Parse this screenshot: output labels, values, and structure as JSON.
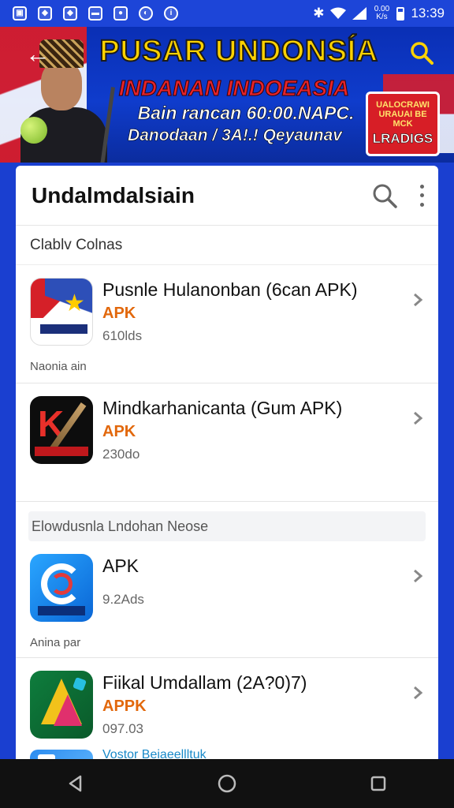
{
  "status_bar": {
    "time": "13:39",
    "data_label": "0.00 K/s",
    "icons": [
      "image-icon",
      "gallery-icon",
      "gallery-icon",
      "briefcase-icon",
      "camera-icon",
      "media-icon",
      "info-icon"
    ]
  },
  "banner": {
    "title": "PUSAR UNDONSÍA",
    "subtitle": "INDANAN INDOEASIA",
    "line1": "Bain rancan 60:00.NAPC.",
    "line2": "Danodaan / 3A!.! Qeyaunav",
    "badge_top": "UALOCRAWI URAUAI BE MCK",
    "badge_big": "LRADIGS"
  },
  "header": {
    "title": "Undalmdalsiain"
  },
  "section_label": "Clablv Colnas",
  "apps": [
    {
      "title": "Pusnle Hulanonban (6can APK)",
      "type": "APK",
      "size": "610lds",
      "note": "Naonia ain",
      "icon": "flag-star-icon"
    },
    {
      "title": "Mindkarhanicanta (Gum APK)",
      "type": "APK",
      "size": "230do",
      "note": "",
      "icon": "knife-logo-icon"
    }
  ],
  "group_label": "Elowdusnla Lndohan Neose",
  "apps2": [
    {
      "title": "APK",
      "type": "",
      "size": "9.2Ads",
      "note": "Anina par",
      "icon": "ring-logo-icon"
    },
    {
      "title": "Fiikal Umdallam (2A?0)7)",
      "type": "APPK",
      "size": "097.03",
      "note": "",
      "icon": "triangle-logo-icon"
    }
  ],
  "last_item": {
    "title": "Vostor Beiaeellltuk"
  },
  "colors": {
    "accent_orange": "#e2680c",
    "primary_blue": "#1a3fd0",
    "nav_black": "#111111"
  }
}
